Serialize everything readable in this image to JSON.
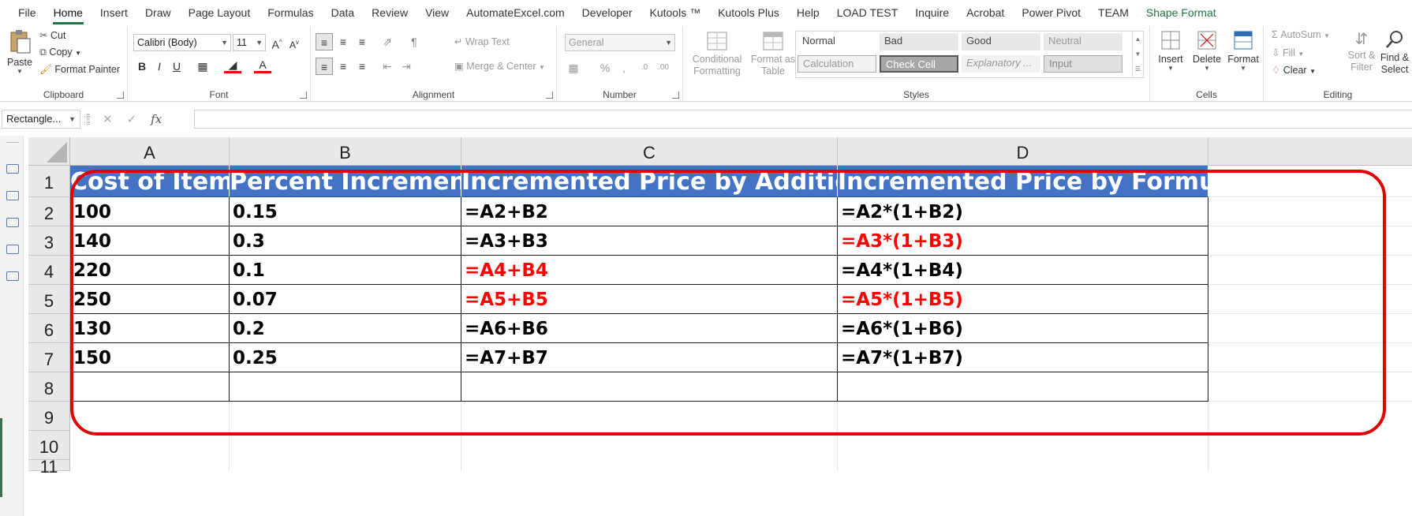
{
  "tabs": [
    "File",
    "Home",
    "Insert",
    "Draw",
    "Page Layout",
    "Formulas",
    "Data",
    "Review",
    "View",
    "AutomateExcel.com",
    "Developer",
    "Kutools ™",
    "Kutools Plus",
    "Help",
    "LOAD TEST",
    "Inquire",
    "Acrobat",
    "Power Pivot",
    "TEAM",
    "Shape Format"
  ],
  "active_tab": "Home",
  "ribbon": {
    "clipboard": {
      "paste": "Paste",
      "cut": "Cut",
      "copy": "Copy",
      "format_painter": "Format Painter",
      "label": "Clipboard"
    },
    "font": {
      "name": "Calibri (Body)",
      "size": "11",
      "label": "Font"
    },
    "alignment": {
      "wrap_text": "Wrap Text",
      "merge_center": "Merge & Center",
      "label": "Alignment"
    },
    "number": {
      "format": "General",
      "label": "Number"
    },
    "styles": {
      "conditional_formatting": [
        "Conditional",
        "Formatting"
      ],
      "format_as_table": [
        "Format as",
        "Table"
      ],
      "cells": [
        "Normal",
        "Bad",
        "Good",
        "Neutral",
        "Calculation",
        "Check Cell",
        "Explanatory ...",
        "Input"
      ],
      "label": "Styles"
    },
    "cells": {
      "insert": "Insert",
      "delete": "Delete",
      "format": "Format",
      "label": "Cells"
    },
    "editing": {
      "autosum": "AutoSum",
      "fill": "Fill",
      "clear": "Clear",
      "sort_filter": [
        "Sort &",
        "Filter"
      ],
      "find_select": [
        "Find &",
        "Select"
      ],
      "label": "Editing"
    }
  },
  "formula_bar": {
    "name_box": "Rectangle...",
    "fx": "fx",
    "content": ""
  },
  "sheet": {
    "columns": [
      "A",
      "B",
      "C",
      "D"
    ],
    "rows": [
      "1",
      "2",
      "3",
      "4",
      "5",
      "6",
      "7",
      "8",
      "9",
      "10",
      "11"
    ],
    "header": [
      "Cost of Items",
      "Percent Increment",
      "Incremented Price by Addition",
      "Incremented Price by Formula"
    ],
    "data": [
      [
        "100",
        "0.15",
        "=A2+B2",
        "=A2*(1+B2)"
      ],
      [
        "140",
        "0.3",
        "=A3+B3",
        "=A3*(1+B3)"
      ],
      [
        "220",
        "0.1",
        "=A4+B4",
        "=A4*(1+B4)"
      ],
      [
        "250",
        "0.07",
        "=A5+B5",
        "=A5*(1+B5)"
      ],
      [
        "130",
        "0.2",
        "=A6+B6",
        "=A6*(1+B6)"
      ],
      [
        "150",
        "0.25",
        "=A7+B7",
        "=A7*(1+B7)"
      ]
    ],
    "red_cells": [
      "D3",
      "C4",
      "C5",
      "D5"
    ],
    "colors": {
      "header_fill": "#4472C4",
      "header_text": "#FFFFFF",
      "highlight_text": "#FF0000",
      "shape_outline": "#E30000",
      "accent": "#217346"
    }
  }
}
